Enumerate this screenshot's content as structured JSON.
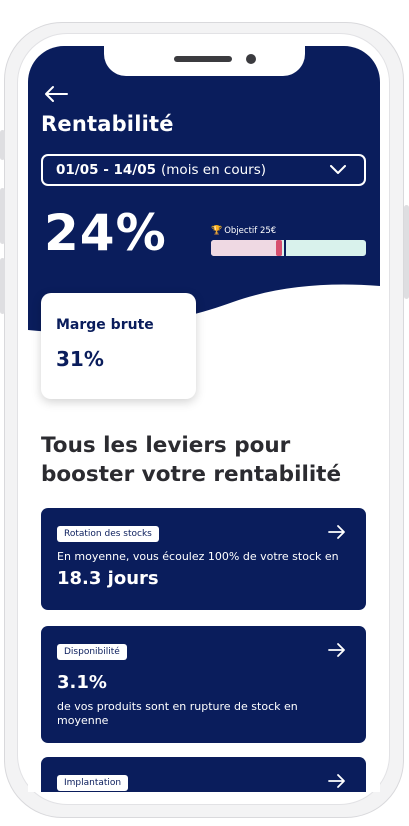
{
  "header": {
    "title": "Rentabilité",
    "period_range": "01/05 - 14/05",
    "period_sub": "(mois en cours)",
    "main_value": "24%",
    "goal_label": "Objectif 25€",
    "goal_progress": 0.46
  },
  "margin_card": {
    "label": "Marge brute",
    "value": "31%"
  },
  "section": {
    "title": "Tous les leviers pour booster votre rentabilité"
  },
  "levers": [
    {
      "tag": "Rotation des stocks",
      "text": "En moyenne, vous écoulez 100% de votre stock en",
      "value": "18.3 jours"
    },
    {
      "tag": "Disponibilité",
      "value": "3.1%",
      "text": "de vos produits sont en rupture de stock en moyenne"
    },
    {
      "tag": "Implantation"
    }
  ],
  "colors": {
    "brand_navy": "#0a1d5c",
    "goal_marker": "#d7506f",
    "goal_ok": "#d9f2ec",
    "goal_below": "#efd9e3"
  },
  "icons": {
    "back": "arrow-left-icon",
    "select": "chevron-down-icon",
    "goal": "trophy-icon",
    "lever_link": "arrow-right-icon"
  }
}
